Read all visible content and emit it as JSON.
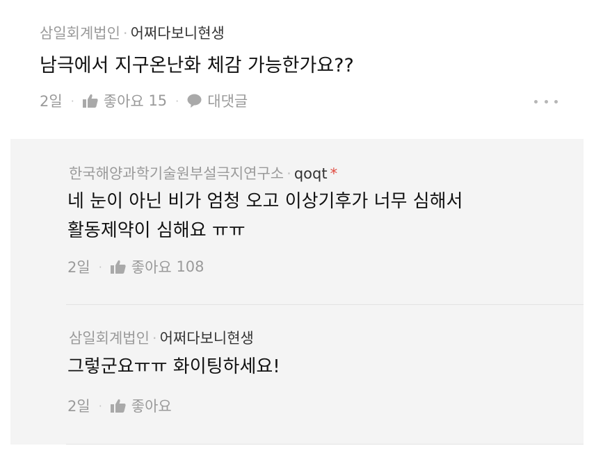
{
  "post": {
    "company": "삼일회계법인",
    "separator": "·",
    "nickname": "어쩌다보니현생",
    "title": "남극에서 지구온난화 체감 가능한가요??",
    "time": "2일",
    "like_label": "좋아요",
    "like_count": "15",
    "comment_label": "대댓글"
  },
  "replies": [
    {
      "company": "한국해양과학기술원부설극지연구소",
      "nickname": "qoqt",
      "author_mark": "*",
      "body_line1": "네 눈이 아닌 비가 엄청 오고 이상기후가 너무 심해서",
      "body_line2": "활동제약이 심해요 ㅠㅠ",
      "time": "2일",
      "like_label": "좋아요",
      "like_count": "108"
    },
    {
      "company": "삼일회계법인",
      "nickname": "어쩌다보니현생",
      "body_line1": "그렇군요ㅠㅠ 화이팅하세요!",
      "time": "2일",
      "like_label": "좋아요"
    }
  ],
  "icons": {
    "like": "thumbs-up-icon",
    "comment": "speech-bubble-icon",
    "more": "more-dots-icon"
  },
  "colors": {
    "meta_gray": "#9a9a9a",
    "reply_background": "#f4f4f4",
    "author_mark": "#e04a3f"
  }
}
